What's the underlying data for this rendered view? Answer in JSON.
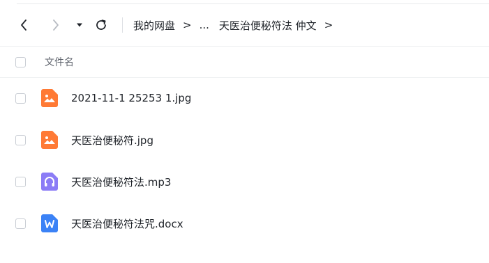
{
  "toolbar": {
    "back_icon": "chevron-left-icon",
    "forward_icon": "chevron-right-icon",
    "history_icon": "caret-down-icon",
    "refresh_icon": "refresh-icon"
  },
  "breadcrumb": {
    "root": "我的网盘",
    "sep1": ">",
    "ellipsis": "...",
    "current": "天医治便秘符法 仲文",
    "sep2": ">"
  },
  "table": {
    "column_name": "文件名"
  },
  "files": [
    {
      "name": "2021-11-1 25253 1.jpg",
      "icon": "image-file-icon",
      "color": "#ff7a35"
    },
    {
      "name": "天医治便秘符.jpg",
      "icon": "image-file-icon",
      "color": "#ff7a35"
    },
    {
      "name": "天医治便秘符法.mp3",
      "icon": "audio-file-icon",
      "color": "#8b7cf6"
    },
    {
      "name": "天医治便秘符法咒.docx",
      "icon": "word-file-icon",
      "color": "#3b82f6"
    }
  ]
}
